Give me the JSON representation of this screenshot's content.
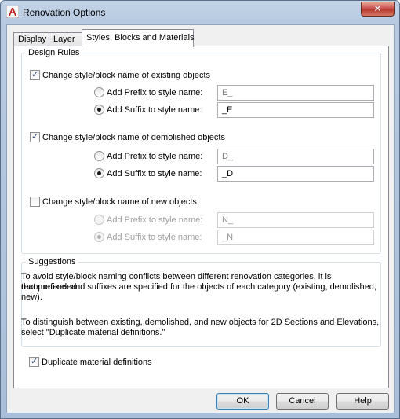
{
  "window": {
    "title": "Renovation Options",
    "close_label": "✕"
  },
  "tabs": [
    {
      "label": "Display",
      "active": false
    },
    {
      "label": "Layer",
      "active": false
    },
    {
      "label": "Styles, Blocks and Materials",
      "active": true
    }
  ],
  "design_rules": {
    "legend": "Design Rules",
    "existing": {
      "label": "Change style/block name of existing objects",
      "checked": true,
      "prefix_label": "Add Prefix to style name:",
      "prefix_value": "E_",
      "suffix_label": "Add Suffix to style name:",
      "suffix_value": "_E",
      "selected": "suffix"
    },
    "demolished": {
      "label": "Change style/block name of demolished objects",
      "checked": true,
      "prefix_label": "Add Prefix to style name:",
      "prefix_value": "D_",
      "suffix_label": "Add Suffix to style name:",
      "suffix_value": "_D",
      "selected": "suffix"
    },
    "new": {
      "label": "Change style/block name of new objects",
      "checked": false,
      "prefix_label": "Add Prefix to style name:",
      "prefix_value": "N_",
      "suffix_label": "Add Suffix to style name:",
      "suffix_value": "_N",
      "selected": "suffix"
    }
  },
  "suggestions": {
    "legend": "Suggestions",
    "para1_line1": "To avoid style/block naming conflicts between different renovation categories, it is recommended",
    "para1_line2": "that prefixes and suffixes are specified for the objects of each category (existing, demolished,",
    "para1_line3": "new).",
    "para2_line1": "To distinguish between existing, demolished, and new objects for 2D Sections and Elevations,",
    "para2_line2": "select \"Duplicate material definitions.\""
  },
  "duplicate": {
    "label": "Duplicate material definitions",
    "checked": true
  },
  "buttons": {
    "ok": "OK",
    "cancel": "Cancel",
    "help": "Help"
  },
  "colors": {
    "title_bg": "#b9cce2",
    "close_red": "#c75050",
    "dialog_bg": "#f0f0f0"
  }
}
